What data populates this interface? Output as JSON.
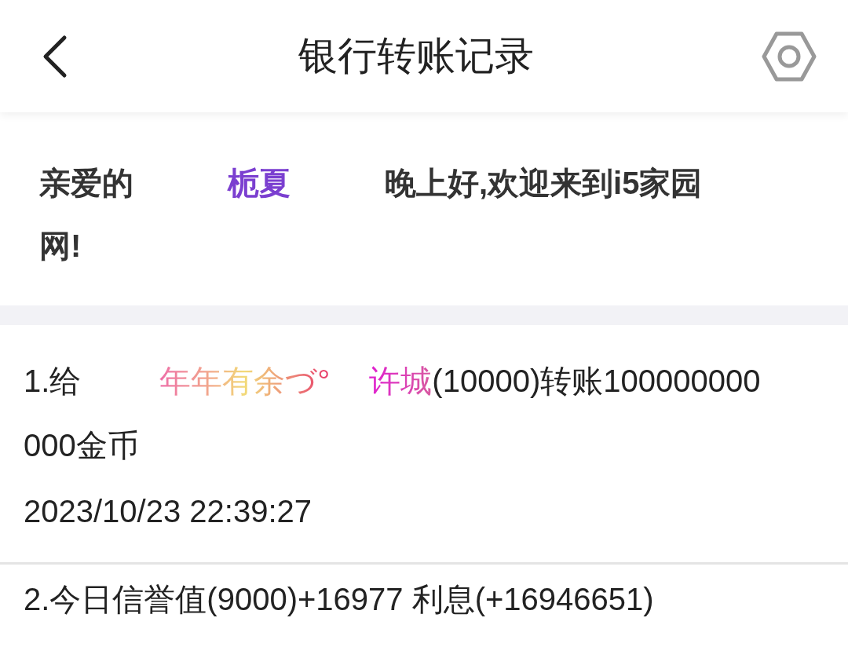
{
  "header": {
    "title": "银行转账记录"
  },
  "greeting": {
    "prefix": "亲爱的",
    "name": "栀夏",
    "message": "晚上好,欢迎来到i5家园网!"
  },
  "records": [
    {
      "kind": "transfer",
      "index": "1.给",
      "sender": "年年有余づ°",
      "receiver": "许城",
      "detail": "(10000)转账100000000000金币",
      "time": "2023/10/23 22:39:27"
    },
    {
      "kind": "plain",
      "text": "2.今日信誉值(9000)+16977 利息(+16946651)"
    }
  ]
}
